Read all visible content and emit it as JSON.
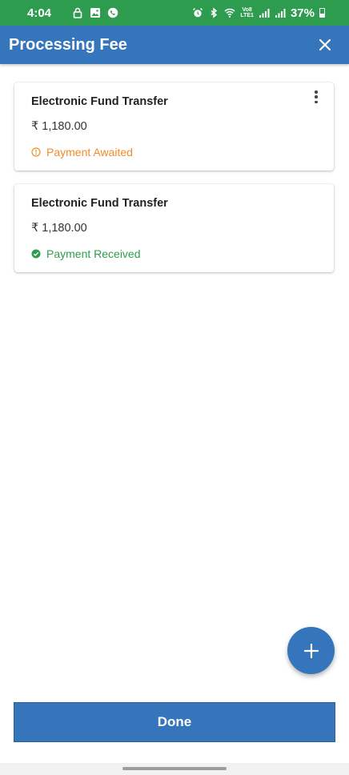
{
  "status_bar": {
    "time": "4:04",
    "battery_percent": "37%",
    "left_icons": [
      "lock-icon",
      "image-icon",
      "whatsapp-icon"
    ],
    "right_icons": [
      "alarm-icon",
      "bluetooth-icon",
      "wifi-icon",
      "volte-icon",
      "signal-icon",
      "signal-icon",
      "battery-icon"
    ],
    "volte_top": "Vo8",
    "volte_bottom": "LTE1",
    "color": "#2e9c4f"
  },
  "app_bar": {
    "title": "Processing Fee",
    "close_icon": "close-icon",
    "color": "#3575bb"
  },
  "payments": [
    {
      "method": "Electronic Fund Transfer",
      "currency_symbol": "₹",
      "amount": "1,180.00",
      "status": "Payment Awaited",
      "status_icon": "info-circle-icon",
      "status_color": "#f28c28",
      "has_menu": true
    },
    {
      "method": "Electronic Fund Transfer",
      "currency_symbol": "₹",
      "amount": "1,180.00",
      "status": "Payment Received",
      "status_icon": "check-circle-icon",
      "status_color": "#2e9c4f",
      "has_menu": false
    }
  ],
  "fab": {
    "icon": "plus-icon"
  },
  "footer": {
    "done_label": "Done"
  }
}
